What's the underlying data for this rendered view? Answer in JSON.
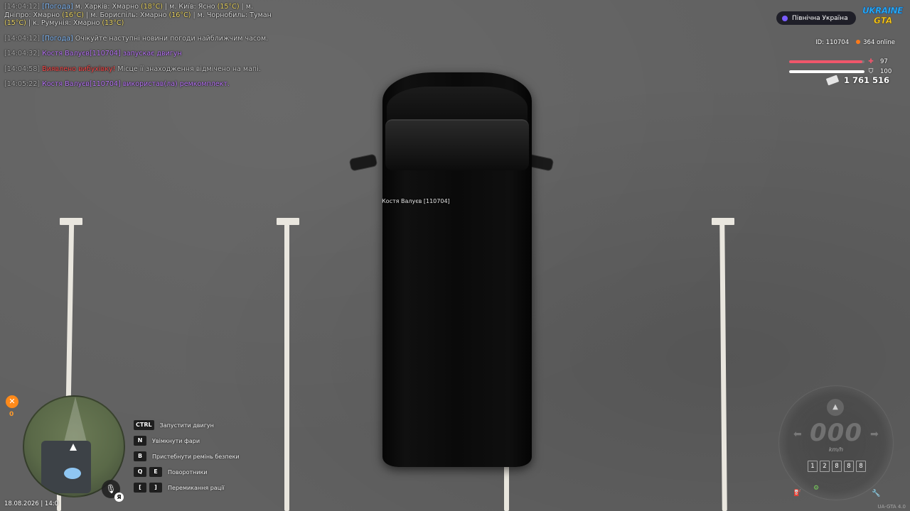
{
  "chat": {
    "lines": [
      {
        "time": "[14:04:12]",
        "tag": "[Погода]",
        "pre": " м. Харків: Хмарно ",
        "t1": "(18°C)",
        "mid1": " | м. Київ: Ясно ",
        "t2": "(15°C)",
        "mid2": " | м. Дніпро: Хмарно ",
        "t3": "(16°C)",
        "mid3": " | м. Бориспіль: Хмарно ",
        "t4": "(16°C)",
        "mid4": " | м. Чорнобиль: Туман ",
        "t5": "(15°C)",
        "mid5": " | к. Румунія: Хмарно ",
        "t6": "(13°C)"
      },
      {
        "time": "[14:04:12]",
        "tag": "[Погода]",
        "text": " Очікуйте наступні новини погоди найближчим часом."
      },
      {
        "time": "[14:04:32]",
        "text": " Костя Валуєв[110704] запускає двигун"
      },
      {
        "time": "[14:04:58]",
        "alert": " Виявлено вибухівку!",
        "text": " Місце її знаходження відмічено на мапі."
      },
      {
        "time": "[14:05:22]",
        "text": " Костя Валуєв[110704] використав(ла) ремкомплект."
      }
    ]
  },
  "player_tag": "Костя Валуєв [110704]",
  "hud": {
    "region": "Північна Україна",
    "logo_top": "UKRAINE",
    "logo_bottom": "GTA",
    "id": "ID: 110704",
    "online": "364 online",
    "health": 97,
    "armor": 100,
    "health_color": "#f0566b",
    "armor_color": "#ffffff",
    "money": "1 761 516"
  },
  "minimap": {
    "repair_count": "0",
    "lang": "Я",
    "datetime": "18.08.2026 | 14:0"
  },
  "hints": [
    {
      "keys": [
        "CTRL"
      ],
      "label": "Запустити двигун"
    },
    {
      "keys": [
        "N"
      ],
      "label": "Увімкнути фари"
    },
    {
      "keys": [
        "B"
      ],
      "label": "Пристебнути ремінь безпеки"
    },
    {
      "keys": [
        "Q",
        "E"
      ],
      "label": "Поворотники"
    },
    {
      "keys": [
        "[",
        "]"
      ],
      "label": "Перемикання рації"
    }
  ],
  "speedometer": {
    "speed": "000",
    "unit": "km/h",
    "odometer": [
      "1",
      "2",
      "8",
      "8",
      "8"
    ]
  },
  "version": "UA-GTA 4.0"
}
